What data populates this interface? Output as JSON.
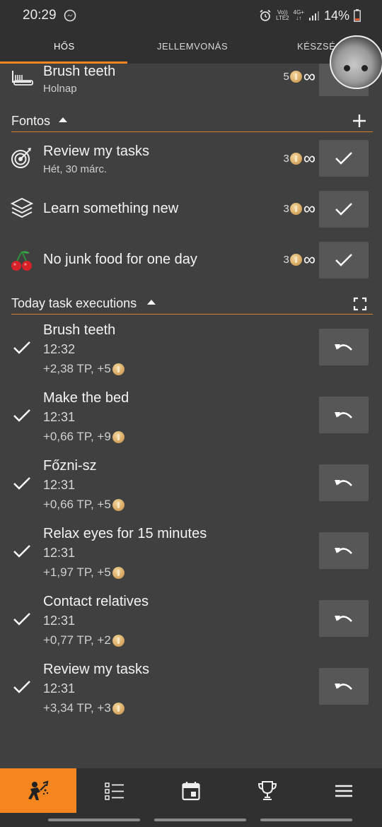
{
  "status_bar": {
    "time": "20:29",
    "messenger_icon": "messenger-icon",
    "alarm_icon": "alarm-icon",
    "volte_top": "Vo))",
    "volte_bottom": "LTE2",
    "network_top": "4G+",
    "network_bottom": "↓↑",
    "battery_percent": "14%"
  },
  "tabs": [
    {
      "label": "HŐS",
      "active": true
    },
    {
      "label": "JELLEMVONÁS",
      "active": false
    },
    {
      "label": "KÉSZSÉG",
      "active": false
    }
  ],
  "top_task": {
    "title": "Brush teeth",
    "subtitle": "Holnap",
    "reward_count": "5",
    "icon": "toothbrush-icon"
  },
  "sections": {
    "important": {
      "label": "Fontos",
      "add_icon": "plus-icon"
    },
    "executions": {
      "label": "Today task executions",
      "expand_icon": "fullscreen-icon"
    }
  },
  "important_tasks": [
    {
      "title": "Review my tasks",
      "subtitle": "Hét, 30 márc.",
      "reward_count": "3",
      "icon": "target-icon"
    },
    {
      "title": "Learn something new",
      "subtitle": "",
      "reward_count": "3",
      "icon": "books-icon"
    },
    {
      "title": "No junk food for one day",
      "subtitle": "",
      "reward_count": "3",
      "icon": "cherry-icon"
    }
  ],
  "executions": [
    {
      "title": "Brush teeth",
      "time": "12:32",
      "gain": "+2,38 TP, +5"
    },
    {
      "title": "Make the bed",
      "time": "12:31",
      "gain": "+0,66 TP, +9"
    },
    {
      "title": "Főzni-sz",
      "time": "12:31",
      "gain": "+0,66 TP, +5"
    },
    {
      "title": "Relax eyes for 15 minutes",
      "time": "12:31",
      "gain": "+1,97 TP, +5"
    },
    {
      "title": "Contact relatives",
      "time": "12:31",
      "gain": "+0,77 TP, +2"
    },
    {
      "title": "Review my tasks",
      "time": "12:31",
      "gain": "+3,34 TP, +3"
    }
  ],
  "bottom_nav": [
    {
      "icon": "hero-icon",
      "active": true
    },
    {
      "icon": "task-list-icon",
      "active": false
    },
    {
      "icon": "calendar-icon",
      "active": false
    },
    {
      "icon": "trophy-icon",
      "active": false
    },
    {
      "icon": "menu-icon",
      "active": false
    }
  ],
  "colors": {
    "accent": "#f5861f",
    "background": "#404040",
    "bar": "#303030",
    "button": "#575757"
  }
}
